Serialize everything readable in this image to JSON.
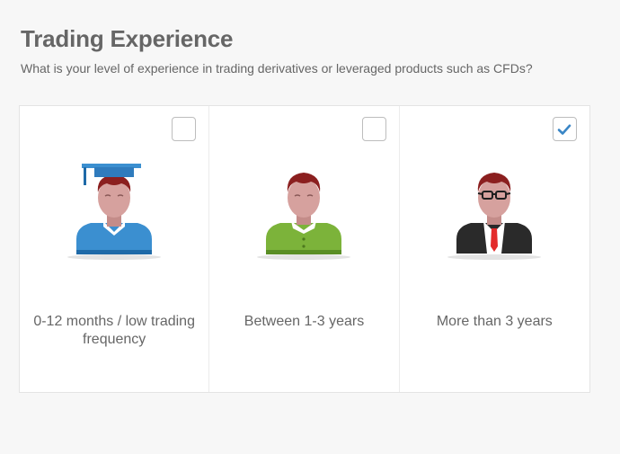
{
  "header": {
    "title": "Trading Experience",
    "subtitle": "What is your level of experience in trading derivatives or leveraged products such as CFDs?"
  },
  "options": [
    {
      "label": "0-12 months / low trading frequency",
      "checked": false,
      "icon": "graduate-avatar-icon",
      "shirt_color": "#3b8fd0"
    },
    {
      "label": "Between 1-3 years",
      "checked": false,
      "icon": "casual-avatar-icon",
      "shirt_color": "#7cb33a"
    },
    {
      "label": "More than 3 years",
      "checked": true,
      "icon": "businessman-avatar-icon",
      "shirt_color": "#2a2a2a"
    }
  ],
  "colors": {
    "text": "#666666",
    "check": "#3a86c6",
    "hair": "#8b1f1f",
    "skin": "#d6a19e"
  }
}
